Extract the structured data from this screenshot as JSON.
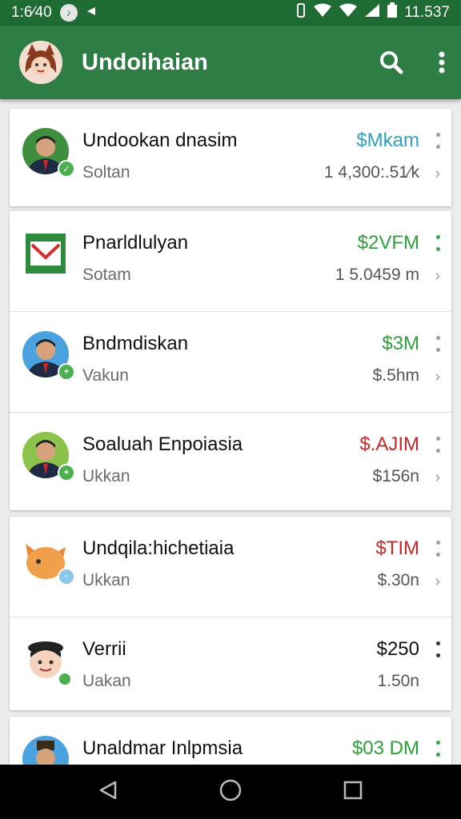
{
  "status_bar": {
    "time": "1:6⁄40",
    "clock_right": "11.537"
  },
  "app_bar": {
    "title": "Undoihaian"
  },
  "colors": {
    "app_bar": "#2e7d44",
    "status_bar": "#1f6b34",
    "teal_amount": "#2f9fc3",
    "green_amount": "#2e9f3a",
    "red_amount": "#c62828",
    "dark_amount": "#111111"
  },
  "list": [
    {
      "title": "Undookan dnasim",
      "subtitle": "Soltan",
      "amount": "$Mkam",
      "value": "1  4,300:.51⁄k",
      "avatar": "man-suit-avatar",
      "badge": "check-badge"
    },
    {
      "title": "Pnarldlulyan",
      "subtitle": "Sotam",
      "amount": "$2VFM",
      "value": "1 5.0459 m",
      "avatar": "gmail-envelope-avatar"
    },
    {
      "title": "Bndmdiskan",
      "subtitle": "Vakun",
      "amount": "$3M",
      "value": "$.5hm",
      "avatar": "man-suit-avatar-blue",
      "badge": "plus-badge"
    },
    {
      "title": "Soaluah Enpoiasia",
      "subtitle": "Ukkan",
      "amount": "$.AJIM",
      "value": "$156n",
      "avatar": "man-suit-avatar-green",
      "badge": "plus-badge"
    },
    {
      "title": "Undqila:hichetiaia",
      "subtitle": "Ukkan",
      "amount": "$TIM",
      "value": "$.30n",
      "avatar": "fox-avatar",
      "badge": "blue-badge"
    },
    {
      "title": "Verrii",
      "subtitle": "Uakan",
      "amount": "$250",
      "value": "1.50n",
      "avatar": "cartoon-boy-avatar",
      "badge": "green-dot-badge"
    },
    {
      "title": "Unaldmar Inlpmsia",
      "subtitle": "",
      "amount": "$03 DM",
      "value": "",
      "avatar": "man-hat-avatar"
    }
  ],
  "nav": {
    "back": "back-icon",
    "home": "home-icon",
    "recents": "recents-icon"
  }
}
